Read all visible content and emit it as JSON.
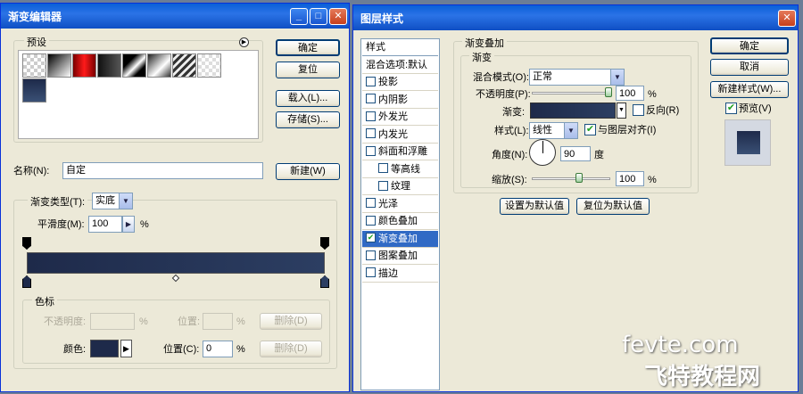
{
  "gradient_editor": {
    "title": "渐变编辑器",
    "presets_label": "预设",
    "ok": "确定",
    "reset": "复位",
    "load": "载入(L)...",
    "save": "存储(S)...",
    "name_label": "名称(N):",
    "name_value": "自定",
    "new": "新建(W)",
    "gradient_type_label": "渐变类型(T):",
    "gradient_type_value": "实底",
    "smoothness_label": "平滑度(M):",
    "smoothness_value": "100",
    "percent": "%",
    "stops_legend": "色标",
    "opacity_label": "不透明度:",
    "location_label_disabled": "位置:",
    "delete_label": "删除(D)",
    "color_label": "颜色:",
    "location_label": "位置(C):",
    "location_value": "0",
    "colors": {
      "gradient_start": "#1e2a4a",
      "gradient_end": "#2c3e62"
    }
  },
  "layer_style": {
    "title": "图层样式",
    "style_items": [
      {
        "label": "样式",
        "checkbox": false,
        "checked": false
      },
      {
        "label": "混合选项:默认",
        "checkbox": false,
        "checked": false
      },
      {
        "label": "投影",
        "checkbox": true,
        "checked": false
      },
      {
        "label": "内阴影",
        "checkbox": true,
        "checked": false
      },
      {
        "label": "外发光",
        "checkbox": true,
        "checked": false
      },
      {
        "label": "内发光",
        "checkbox": true,
        "checked": false
      },
      {
        "label": "斜面和浮雕",
        "checkbox": true,
        "checked": false
      },
      {
        "label": "等高线",
        "checkbox": true,
        "checked": false
      },
      {
        "label": "纹理",
        "checkbox": true,
        "checked": false
      },
      {
        "label": "光泽",
        "checkbox": true,
        "checked": false
      },
      {
        "label": "颜色叠加",
        "checkbox": true,
        "checked": false
      },
      {
        "label": "渐变叠加",
        "checkbox": true,
        "checked": true
      },
      {
        "label": "图案叠加",
        "checkbox": true,
        "checked": false
      },
      {
        "label": "描边",
        "checkbox": true,
        "checked": false
      }
    ],
    "section_title": "渐变叠加",
    "subsection_title": "渐变",
    "blend_mode_label": "混合模式(O):",
    "blend_mode_value": "正常",
    "opacity_label": "不透明度(P):",
    "opacity_value": "100",
    "opacity_level": 1.0,
    "gradient_label": "渐变:",
    "reverse_label": "反向(R)",
    "style_label": "样式(L):",
    "style_value": "线性",
    "align_label": "与图层对齐(I)",
    "angle_label": "角度(N):",
    "angle_value": "90",
    "degree": "度",
    "scale_label": "缩放(S):",
    "scale_value": "100",
    "scale_level": 0.6,
    "percent": "%",
    "make_default": "设置为默认值",
    "reset_default": "复位为默认值",
    "ok": "确定",
    "cancel": "取消",
    "new_style": "新建样式(W)...",
    "preview_label": "预览(V)"
  },
  "watermark": {
    "line1": "fevte.com",
    "line2": "飞特教程网"
  }
}
